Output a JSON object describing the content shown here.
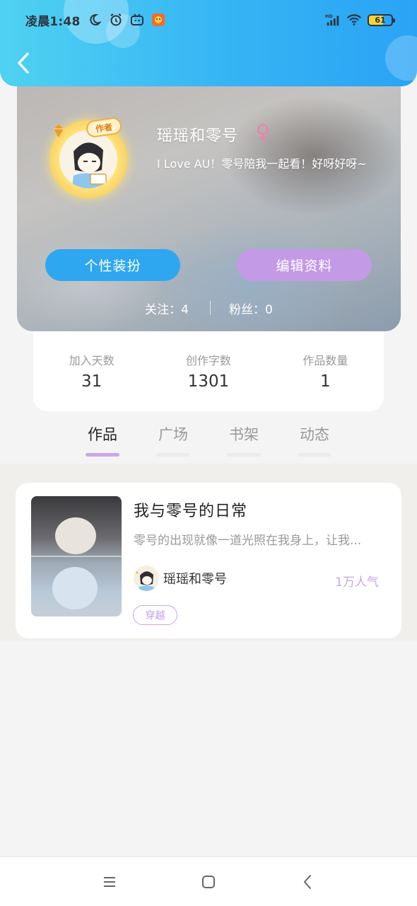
{
  "status_bar": {
    "time": "凌晨1:48",
    "left_icons": [
      "moon-icon",
      "alarm-icon",
      "tv-app-icon",
      "app-notification-icon"
    ],
    "right_icons": [
      "hd-signal-icon",
      "wifi-icon",
      "battery-icon"
    ],
    "battery_level": "61"
  },
  "header": {
    "back_icon": "chevron-left-icon",
    "gradient_colors": [
      "#4fd2f2",
      "#2aa3f5"
    ]
  },
  "profile": {
    "avatar_badge": "作者",
    "name": "瑶瑶和零号",
    "gender_icon": "female-icon",
    "bio": "I Love AU！零号陪我一起看！好呀好呀~",
    "dress_button": "个性装扮",
    "edit_button": "编辑资料",
    "follow_text": "关注：4",
    "fans_text": "粉丝：0"
  },
  "stats": [
    {
      "label": "加入天数",
      "value": "31"
    },
    {
      "label": "创作字数",
      "value": "1301"
    },
    {
      "label": "作品数量",
      "value": "1"
    }
  ],
  "tabs": [
    {
      "label": "作品",
      "active": true
    },
    {
      "label": "广场",
      "active": false
    },
    {
      "label": "书架",
      "active": false
    },
    {
      "label": "动态",
      "active": false
    }
  ],
  "works": [
    {
      "title": "我与零号的日常",
      "description": "零号的出现就像一道光照在我身上，让我...",
      "author": "瑶瑶和零号",
      "popularity": "1万人气",
      "tag": "穿越"
    }
  ],
  "nav_bar": {
    "icons": [
      "menu-icon",
      "home-square-icon",
      "back-triangle-icon"
    ]
  },
  "colors": {
    "accent_blue": "#2ea7f0",
    "accent_purple": "#c39ae6",
    "tab_indicator": "#c9a7ea"
  }
}
